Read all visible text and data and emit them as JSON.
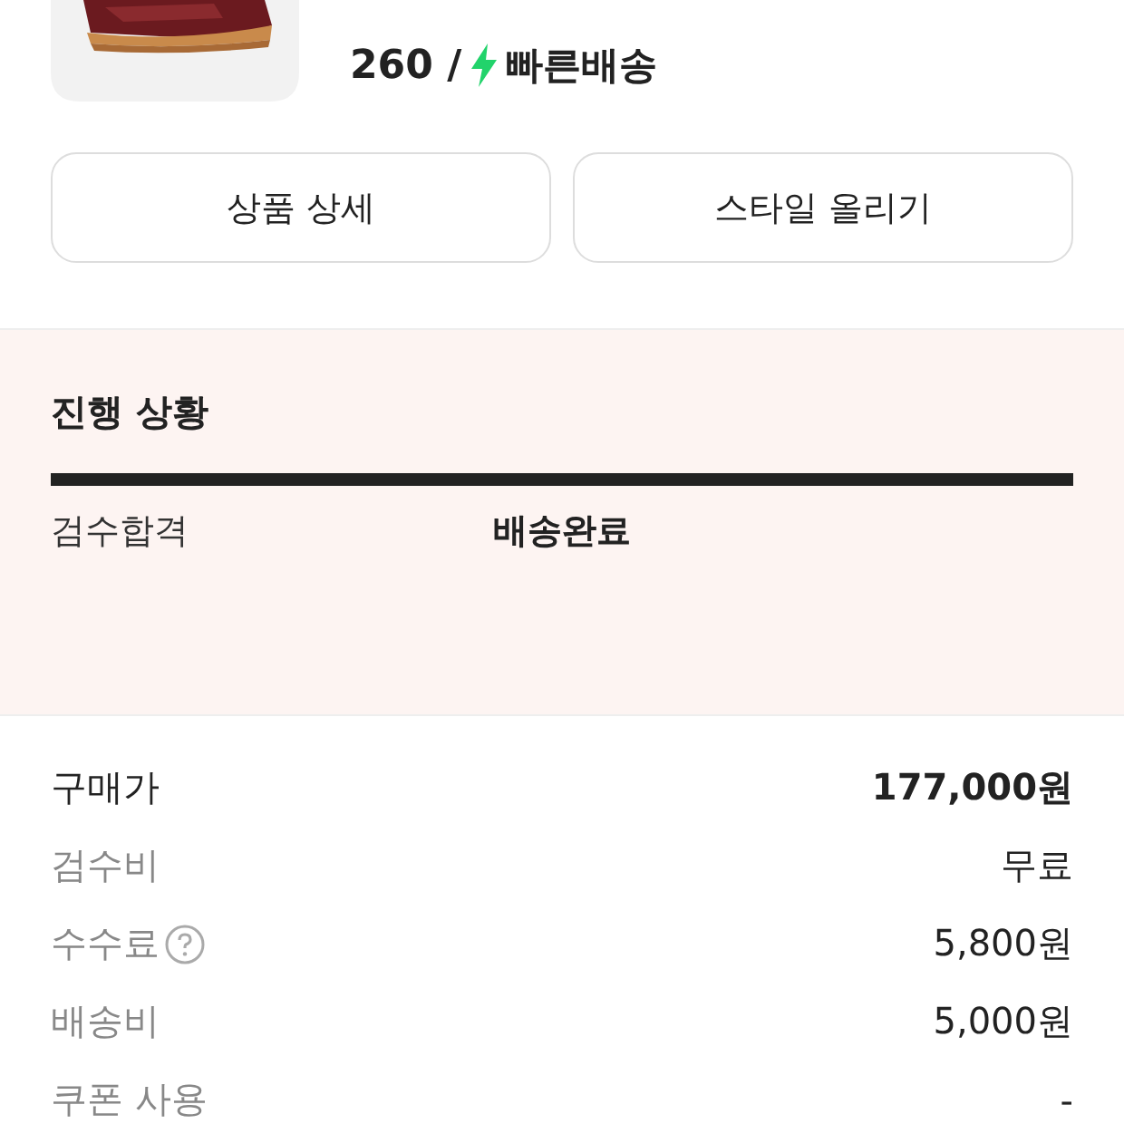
{
  "product": {
    "size": "260 /",
    "shipping": "빠른배송"
  },
  "buttons": [
    "상품 상세",
    "스타일 올리기"
  ],
  "progress": {
    "title": "진행 상황",
    "level": 1,
    "steps": [
      {
        "label": "검수합격",
        "selected": false
      },
      {
        "label": "배송완료",
        "selected": true
      }
    ]
  },
  "prices": [
    {
      "label": "구매가",
      "value": "177,000원",
      "kind": "main",
      "help": false
    },
    {
      "label": "검수비",
      "value": "무료",
      "kind": "sub",
      "help": false
    },
    {
      "label": "수수료",
      "value": "5,800원",
      "kind": "sub",
      "help": true
    },
    {
      "label": "배송비",
      "value": "5,000원",
      "kind": "sub",
      "help": false
    },
    {
      "label": "쿠폰 사용",
      "value": "-",
      "kind": "sub",
      "help": false
    }
  ]
}
